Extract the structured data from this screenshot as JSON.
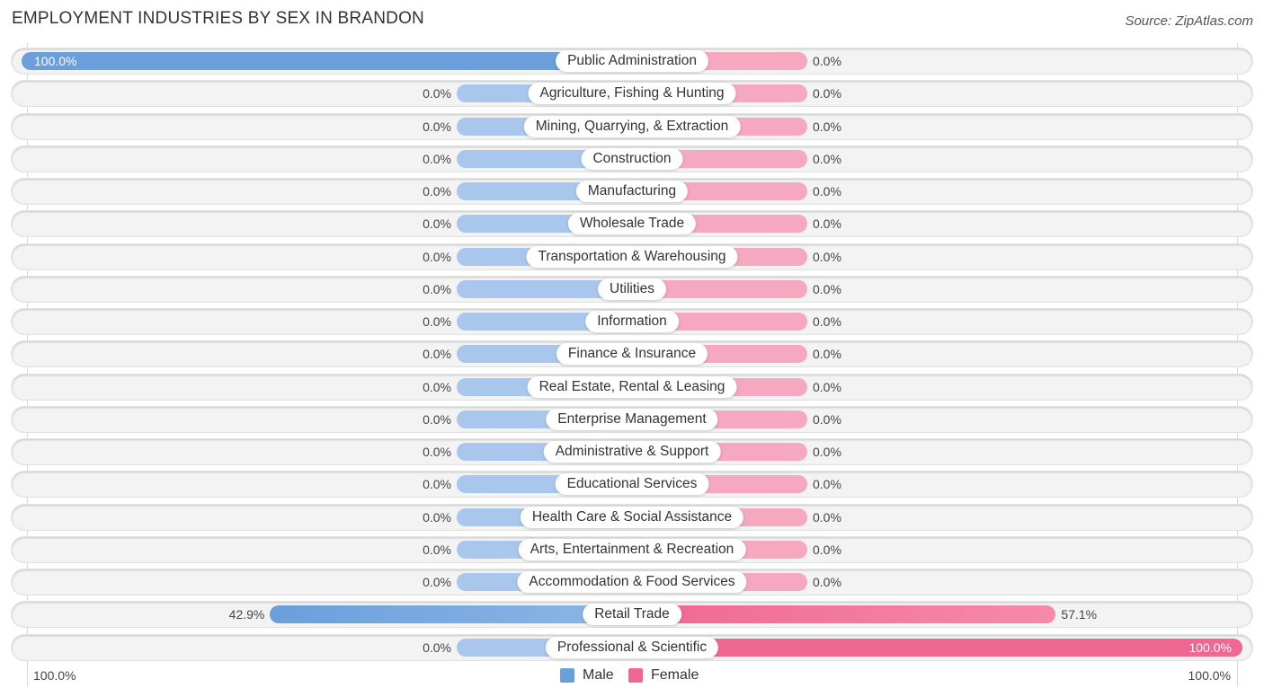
{
  "title": "EMPLOYMENT INDUSTRIES BY SEX IN BRANDON",
  "source": "Source: ZipAtlas.com",
  "colors": {
    "male": "#6a9fdc",
    "male_light": "#a9c7ec",
    "female": "#f06892",
    "female_light": "#f5a8c0"
  },
  "chart_data": {
    "type": "bar",
    "orientation": "horizontal-diverging",
    "title": "EMPLOYMENT INDUSTRIES BY SEX IN BRANDON",
    "categories": [
      "Public Administration",
      "Agriculture, Fishing & Hunting",
      "Mining, Quarrying, & Extraction",
      "Construction",
      "Manufacturing",
      "Wholesale Trade",
      "Transportation & Warehousing",
      "Utilities",
      "Information",
      "Finance & Insurance",
      "Real Estate, Rental & Leasing",
      "Enterprise Management",
      "Administrative & Support",
      "Educational Services",
      "Health Care & Social Assistance",
      "Arts, Entertainment & Recreation",
      "Accommodation & Food Services",
      "Retail Trade",
      "Professional & Scientific"
    ],
    "series": [
      {
        "name": "Male",
        "values": [
          100.0,
          0.0,
          0.0,
          0.0,
          0.0,
          0.0,
          0.0,
          0.0,
          0.0,
          0.0,
          0.0,
          0.0,
          0.0,
          0.0,
          0.0,
          0.0,
          0.0,
          42.9,
          0.0
        ],
        "labels": [
          "100.0%",
          "0.0%",
          "0.0%",
          "0.0%",
          "0.0%",
          "0.0%",
          "0.0%",
          "0.0%",
          "0.0%",
          "0.0%",
          "0.0%",
          "0.0%",
          "0.0%",
          "0.0%",
          "0.0%",
          "0.0%",
          "0.0%",
          "42.9%",
          "0.0%"
        ]
      },
      {
        "name": "Female",
        "values": [
          0.0,
          0.0,
          0.0,
          0.0,
          0.0,
          0.0,
          0.0,
          0.0,
          0.0,
          0.0,
          0.0,
          0.0,
          0.0,
          0.0,
          0.0,
          0.0,
          0.0,
          57.1,
          100.0
        ],
        "labels": [
          "0.0%",
          "0.0%",
          "0.0%",
          "0.0%",
          "0.0%",
          "0.0%",
          "0.0%",
          "0.0%",
          "0.0%",
          "0.0%",
          "0.0%",
          "0.0%",
          "0.0%",
          "0.0%",
          "0.0%",
          "0.0%",
          "0.0%",
          "57.1%",
          "100.0%"
        ]
      }
    ],
    "xlim": [
      -100,
      100
    ],
    "axis_labels": {
      "left": "100.0%",
      "right": "100.0%"
    },
    "legend": {
      "position": "bottom-center",
      "entries": [
        "Male",
        "Female"
      ]
    },
    "grid": false
  }
}
